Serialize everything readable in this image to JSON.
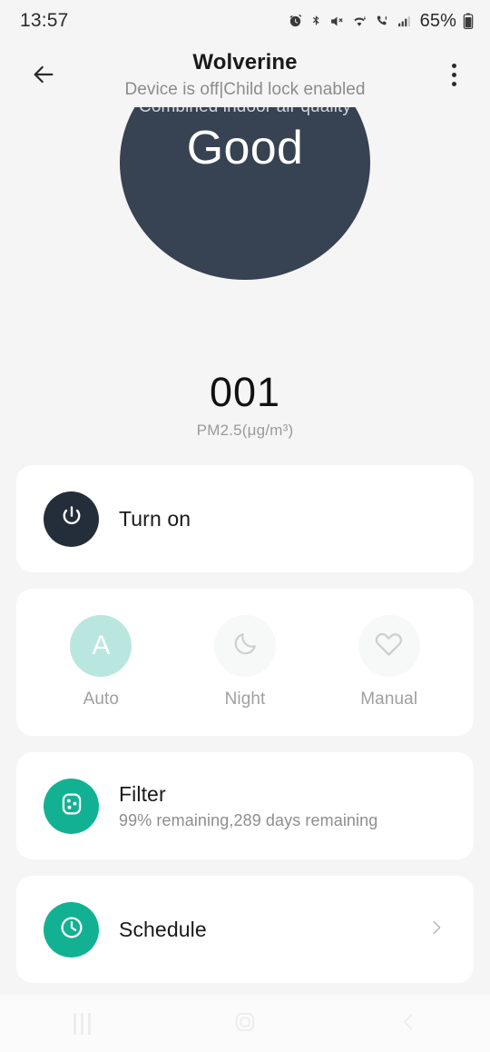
{
  "status_bar": {
    "time": "13:57",
    "battery_percent": "65%",
    "icons": [
      "alarm-icon",
      "bluetooth-icon",
      "mute-icon",
      "wifi-icon",
      "volte-call-icon",
      "signal-icon",
      "battery-icon"
    ]
  },
  "header": {
    "back_icon": "arrow-left-icon",
    "title": "Wolverine",
    "subtitle": "Device is off|Child lock enabled",
    "menu_icon": "more-vertical-icon"
  },
  "air_quality": {
    "caption": "Combined indoor air quality",
    "value": "Good",
    "circle_color": "#374253"
  },
  "pm25": {
    "value": "001",
    "label": "PM2.5(μg/m³)"
  },
  "power_card": {
    "icon": "power-icon",
    "label": "Turn on",
    "icon_bg": "#242e3a"
  },
  "modes": {
    "items": [
      {
        "label": "Auto",
        "icon": "letter-a-icon",
        "selected": true,
        "circle_color": "#b9e7df"
      },
      {
        "label": "Night",
        "icon": "moon-icon",
        "selected": false,
        "circle_color": "#f7f8f8"
      },
      {
        "label": "Manual",
        "icon": "heart-icon",
        "selected": false,
        "circle_color": "#f7f8f8"
      }
    ]
  },
  "filter_card": {
    "icon": "filter-cartridge-icon",
    "title": "Filter",
    "subtitle": "99% remaining,289 days remaining",
    "icon_bg": "#13b194"
  },
  "schedule_card": {
    "icon": "clock-icon",
    "title": "Schedule",
    "chevron_icon": "chevron-right-icon",
    "icon_bg": "#13b194"
  },
  "nav_bar": {
    "recents_icon": "recents-icon",
    "home_icon": "home-icon",
    "back_icon": "nav-back-icon"
  }
}
